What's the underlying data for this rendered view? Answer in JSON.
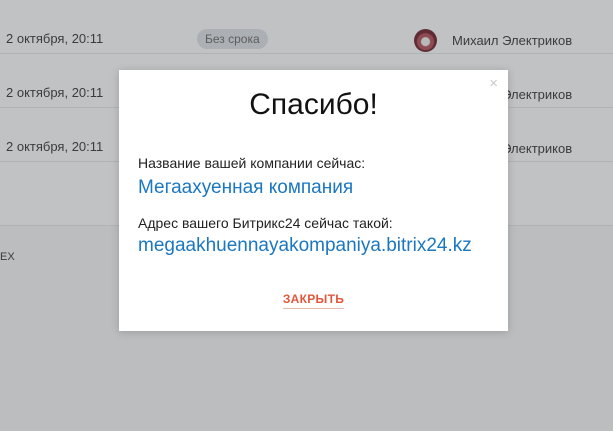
{
  "table": {
    "rows": [
      {
        "date": "2 октября, 20:11",
        "badge": "Без срока",
        "user": "Михаил Электриков"
      },
      {
        "date": "2 октября, 20:11",
        "user": "Михаил Электриков"
      },
      {
        "date": "2 октября, 20:11",
        "user": "Михаил Электриков"
      }
    ],
    "fragment": "EX"
  },
  "modal": {
    "close_icon": "×",
    "title": "Спасибо!",
    "company_label": "Название вашей компании сейчас:",
    "company_value": "Мегаахуенная компания",
    "address_label": "Адрес вашего Битрикс24 сейчас такой:",
    "address_value": "megaakhuennayakompaniya.bitrix24.kz",
    "close_button": "ЗАКРЫТЬ"
  },
  "colors": {
    "accent": "#e2573b",
    "link": "#1b77c0",
    "overlay": "rgba(72,76,82,0.34)"
  }
}
